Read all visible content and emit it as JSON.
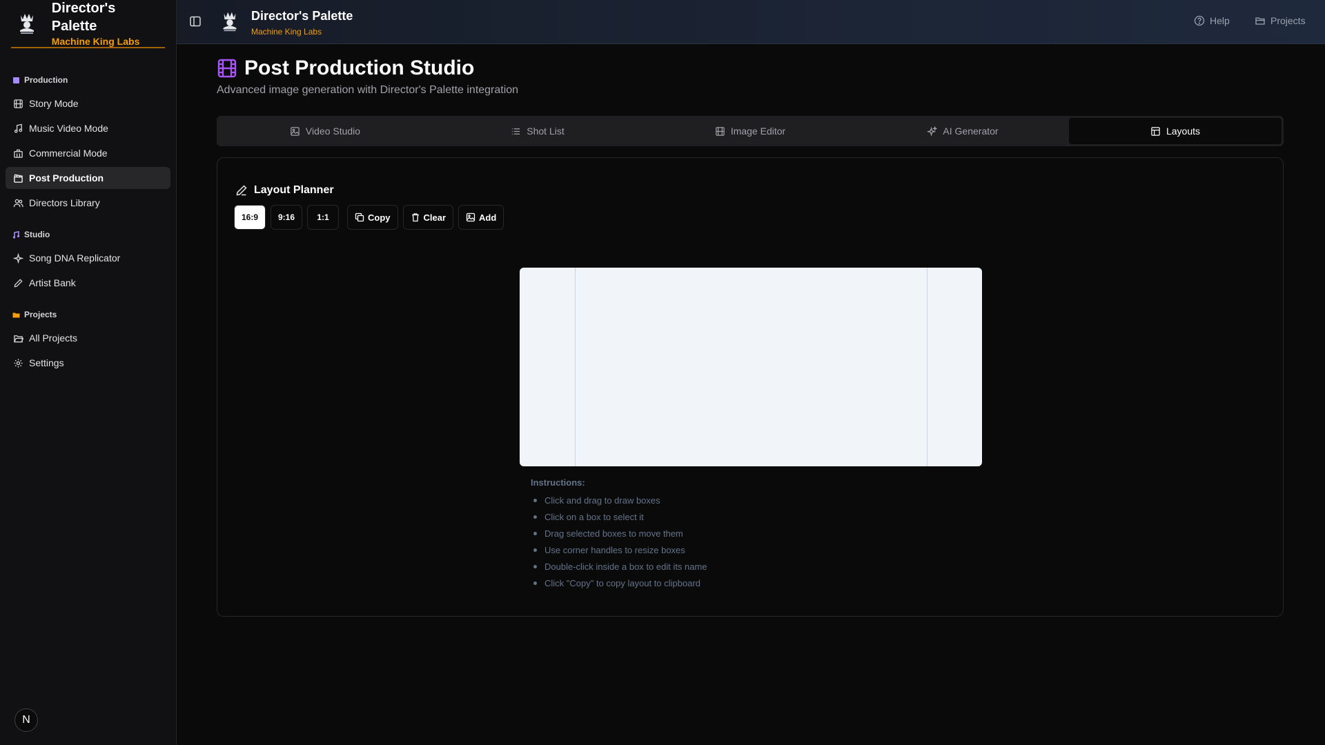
{
  "app": {
    "title": "Director's Palette",
    "subtitle": "Machine King Labs",
    "logo_text": "MACHINE KING LABS"
  },
  "sidebar": {
    "groups": [
      {
        "label": "Production",
        "icon": "clapper-icon",
        "items": [
          {
            "label": "Story Mode",
            "icon": "film-icon"
          },
          {
            "label": "Music Video Mode",
            "icon": "music-note-icon"
          },
          {
            "label": "Commercial Mode",
            "icon": "building-icon"
          },
          {
            "label": "Post Production",
            "icon": "clapperboard-icon",
            "active": true
          },
          {
            "label": "Directors Library",
            "icon": "users-icon"
          }
        ]
      },
      {
        "label": "Studio",
        "icon": "music-icon",
        "items": [
          {
            "label": "Song DNA Replicator",
            "icon": "sparkles-icon"
          },
          {
            "label": "Artist Bank",
            "icon": "pen-icon"
          }
        ]
      },
      {
        "label": "Projects",
        "icon": "folder-icon",
        "items": [
          {
            "label": "All Projects",
            "icon": "folder-open-icon"
          },
          {
            "label": "Settings",
            "icon": "gear-icon"
          }
        ]
      }
    ],
    "avatar_letter": "N"
  },
  "header": {
    "title": "Director's Palette",
    "subtitle": "Machine King Labs",
    "help_label": "Help",
    "projects_label": "Projects"
  },
  "page": {
    "title": "Post Production Studio",
    "subtitle": "Advanced image generation with Director's Palette integration"
  },
  "tabs": [
    {
      "label": "Video Studio",
      "icon": "image-icon"
    },
    {
      "label": "Shot List",
      "icon": "list-icon"
    },
    {
      "label": "Image Editor",
      "icon": "film-icon"
    },
    {
      "label": "AI Generator",
      "icon": "sparkles-icon"
    },
    {
      "label": "Layouts",
      "icon": "layout-icon",
      "active": true
    }
  ],
  "layout_planner": {
    "title": "Layout Planner",
    "ratios": [
      "16:9",
      "9:16",
      "1:1"
    ],
    "selected_ratio": "16:9",
    "copy_label": "Copy",
    "clear_label": "Clear",
    "add_label": "Add",
    "instructions_title": "Instructions:",
    "instructions": [
      "Click and drag to draw boxes",
      "Click on a box to select it",
      "Drag selected boxes to move them",
      "Use corner handles to resize boxes",
      "Double-click inside a box to edit its name",
      "Click \"Copy\" to copy layout to clipboard"
    ]
  },
  "colors": {
    "accent": "#f59e0b",
    "title_icon": "#a855f7",
    "background": "#0a0a0a",
    "canvas": "#f1f5f9"
  }
}
